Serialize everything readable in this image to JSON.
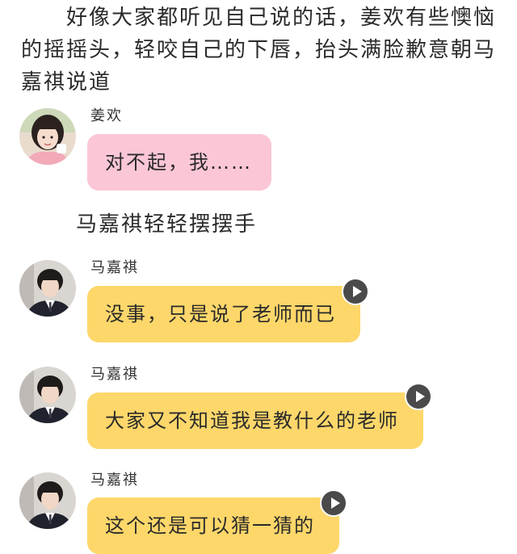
{
  "intro_text": "好像大家都听见自己说的话，姜欢有些懊恼的摇摇头，轻咬自己的下唇，抬头满脸歉意朝马嘉祺说道",
  "aside_text": "马嘉祺轻轻摆摆手",
  "messages": [
    {
      "sender": "姜欢",
      "text": "对不起，我……",
      "bubble_color": "#fbc6d6",
      "avatar": "girl-avatar",
      "has_voice": false
    },
    {
      "sender": "马嘉祺",
      "text": "没事，只是说了老师而已",
      "bubble_color": "#fdd76a",
      "avatar": "boy-avatar",
      "has_voice": true
    },
    {
      "sender": "马嘉祺",
      "text": "大家又不知道我是教什么的老师",
      "bubble_color": "#fdd76a",
      "avatar": "boy-avatar",
      "has_voice": true
    },
    {
      "sender": "马嘉祺",
      "text": "这个还是可以猜一猜的",
      "bubble_color": "#fdd76a",
      "avatar": "boy-avatar",
      "has_voice": true
    }
  ]
}
